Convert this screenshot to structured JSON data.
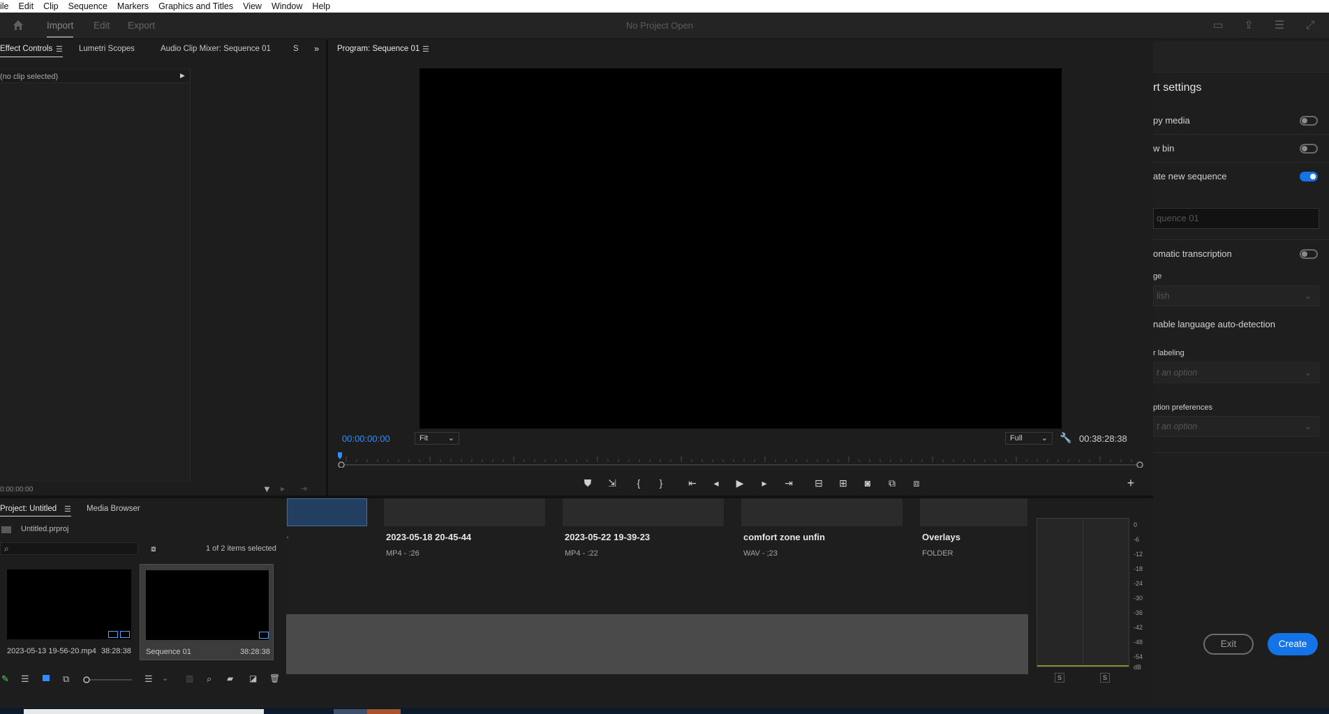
{
  "menu": [
    "ile",
    "Edit",
    "Clip",
    "Sequence",
    "Markers",
    "Graphics and Titles",
    "View",
    "Window",
    "Help"
  ],
  "header": {
    "tabs": [
      "Import",
      "Edit",
      "Export"
    ],
    "title": "No Project Open"
  },
  "source_panel": {
    "tabs": [
      "Effect Controls",
      "Lumetri Scopes",
      "Audio Clip Mixer: Sequence 01",
      "S"
    ],
    "no_clip": "(no clip selected)",
    "timecode": "0:00:00:00"
  },
  "program_monitor": {
    "title": "Program: Sequence 01",
    "current_timecode": "00:00:00:00",
    "zoom": "Fit",
    "resolution": "Full",
    "duration": "00:38:28:38"
  },
  "project_panel": {
    "tabs": [
      "Project: Untitled",
      "Media Browser"
    ],
    "project_file": "Untitled.prproj",
    "selection_count": "1 of 2 items selected",
    "items": [
      {
        "name": "2023-05-13 19-56-20.mp4",
        "duration": "38:28:38"
      },
      {
        "name": "Sequence 01",
        "duration": "38:28:38"
      }
    ]
  },
  "media_strip": [
    {
      "title": "2023-05-18 20-45-44",
      "meta": "MP4 - :26"
    },
    {
      "title": "2023-05-22 19-39-23",
      "meta": "MP4 - :22"
    },
    {
      "title": "comfort zone unfin",
      "meta": "WAV - ;23"
    },
    {
      "title": "Overlays",
      "meta": "FOLDER"
    }
  ],
  "audio_meter": {
    "labels": [
      "0",
      "-6",
      "-12",
      "-18",
      "-24",
      "-30",
      "-36",
      "-42",
      "-48",
      "-54",
      "dB"
    ],
    "solo_labels": [
      "S",
      "S"
    ]
  },
  "import_settings": {
    "heading": "rt settings",
    "copy_media": {
      "label": "py media",
      "on": false
    },
    "new_bin": {
      "label": "w bin",
      "on": false
    },
    "create_sequence": {
      "label": "ate new sequence",
      "on": true
    },
    "sequence_name": "quence 01",
    "auto_transcription": {
      "label": "omatic transcription",
      "on": false
    },
    "language_label": "ge",
    "language_value": "lish",
    "auto_detect": "nable language auto-detection",
    "speaker_label": "r labeling",
    "speaker_placeholder": "t an option",
    "caption_label": "ption preferences",
    "caption_placeholder": "t an option",
    "exit": "Exit",
    "create": "Create"
  },
  "colors": {
    "accent": "#1473e6",
    "timecode": "#2f8dff",
    "selected_thumb": "#223f62"
  }
}
